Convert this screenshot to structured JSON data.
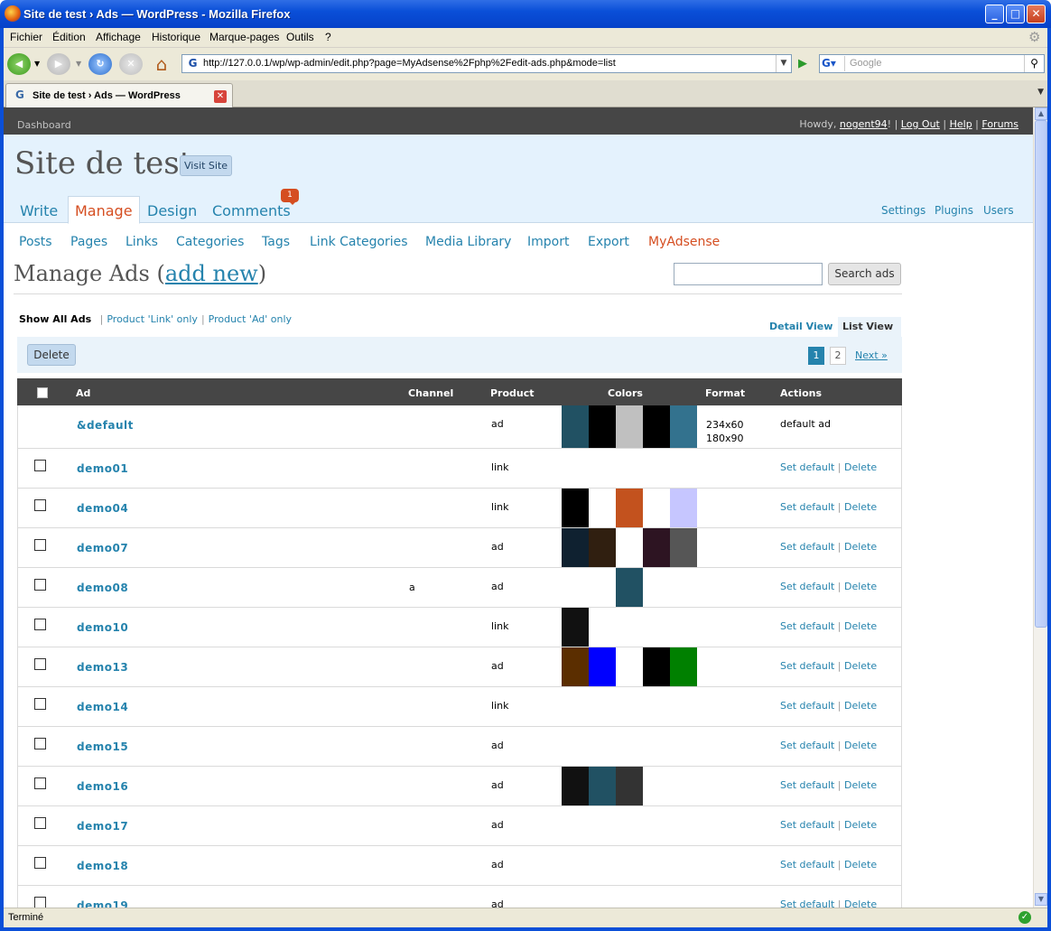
{
  "window": {
    "title": "Site de test › Ads — WordPress - Mozilla Firefox"
  },
  "menu": [
    "Fichier",
    "Édition",
    "Affichage",
    "Historique",
    "Marque-pages",
    "Outils",
    "?"
  ],
  "navbar": {
    "url": "http://127.0.0.1/wp/wp-admin/edit.php?page=MyAdsense%2Fphp%2Fedit-ads.php&mode=list",
    "search_placeholder": "Google"
  },
  "tab": {
    "title": "Site de test › Ads — WordPress"
  },
  "status": "Terminé",
  "wp": {
    "dashboard": "Dashboard",
    "howdy": "Howdy,",
    "user": "nogent94",
    "logout": "Log Out",
    "help": "Help",
    "forums": "Forums",
    "blog_title": "Site de test",
    "visit_site": "Visit Site",
    "main_tabs": [
      "Write",
      "Manage",
      "Design",
      "Comments"
    ],
    "comments_count": "1",
    "right_tabs": [
      "Settings",
      "Plugins",
      "Users"
    ],
    "sub_nav": [
      "Posts",
      "Pages",
      "Links",
      "Categories",
      "Tags",
      "Link Categories",
      "Media Library",
      "Import",
      "Export",
      "MyAdsense"
    ],
    "page_title": "Manage Ads (",
    "add_new": "add new",
    "page_title_end": ")",
    "search_button": "Search ads",
    "filters": {
      "all": "Show All Ads",
      "link": "Product 'Link' only",
      "ad": "Product 'Ad' only"
    },
    "views": {
      "detail": "Detail View",
      "list": "List View"
    },
    "delete_button": "Delete",
    "pages": {
      "current": "1",
      "next_page": "2",
      "next": "Next »"
    },
    "columns": {
      "ad": "Ad",
      "channel": "Channel",
      "product": "Product",
      "colors": "Colors",
      "format": "Format",
      "actions": "Actions"
    },
    "set_default": "Set default",
    "delete_link": "Delete",
    "sep": "|",
    "ads": [
      {
        "name": "&default",
        "channel": "",
        "product": "ad",
        "colors": [
          "#215163",
          "#000000",
          "#c0c0c0",
          "#000000",
          "#33728e"
        ],
        "format": "234x60\n180x90",
        "action": "default ad",
        "is_default": true
      },
      {
        "name": "demo01",
        "channel": "",
        "product": "link",
        "colors": [
          null,
          null,
          null,
          null,
          null
        ],
        "format": ""
      },
      {
        "name": "demo04",
        "channel": "",
        "product": "link",
        "colors": [
          "#000000",
          null,
          "#c3521e",
          null,
          "#c6c6ff"
        ],
        "format": ""
      },
      {
        "name": "demo07",
        "channel": "",
        "product": "ad",
        "colors": [
          "#0f2130",
          "#301f10",
          null,
          "#2d1422",
          "#565656"
        ],
        "format": ""
      },
      {
        "name": "demo08",
        "channel": "a",
        "product": "ad",
        "colors": [
          null,
          null,
          "#215163",
          null,
          null
        ],
        "format": ""
      },
      {
        "name": "demo10",
        "channel": "",
        "product": "link",
        "colors": [
          "#111111",
          null,
          null,
          null,
          null
        ],
        "format": ""
      },
      {
        "name": "demo13",
        "channel": "",
        "product": "ad",
        "colors": [
          "#5b2e00",
          "#0000ff",
          null,
          "#000000",
          "#008000"
        ],
        "format": ""
      },
      {
        "name": "demo14",
        "channel": "",
        "product": "link",
        "colors": [
          null,
          null,
          null,
          null,
          null
        ],
        "format": ""
      },
      {
        "name": "demo15",
        "channel": "",
        "product": "ad",
        "colors": [
          null,
          null,
          null,
          null,
          null
        ],
        "format": ""
      },
      {
        "name": "demo16",
        "channel": "",
        "product": "ad",
        "colors": [
          "#111111",
          "#215163",
          "#333333",
          null,
          null
        ],
        "format": ""
      },
      {
        "name": "demo17",
        "channel": "",
        "product": "ad",
        "colors": [
          null,
          null,
          null,
          null,
          null
        ],
        "format": ""
      },
      {
        "name": "demo18",
        "channel": "",
        "product": "ad",
        "colors": [
          null,
          null,
          null,
          null,
          null
        ],
        "format": ""
      },
      {
        "name": "demo19",
        "channel": "",
        "product": "ad",
        "colors": [
          null,
          null,
          null,
          null,
          null
        ],
        "format": ""
      }
    ]
  }
}
